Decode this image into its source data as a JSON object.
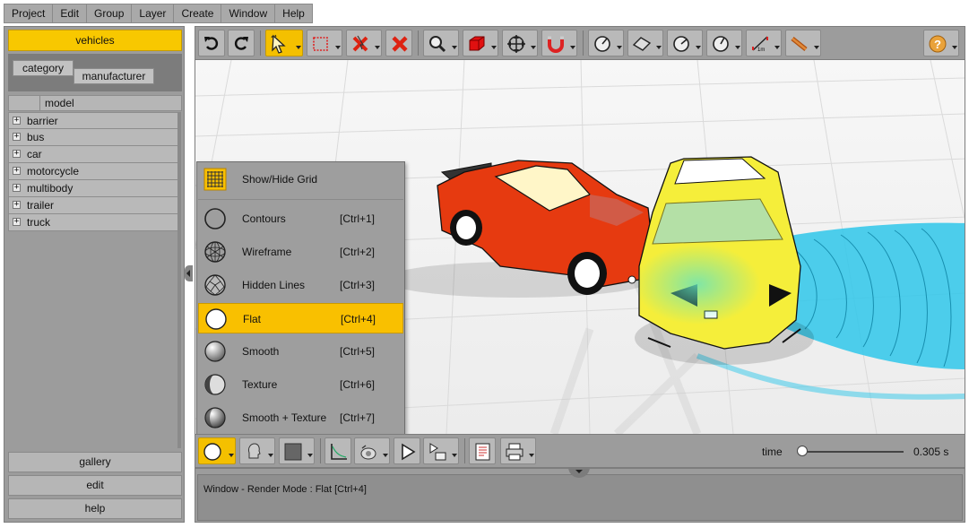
{
  "menubar": {
    "items": [
      {
        "label": "Project"
      },
      {
        "label": "Edit"
      },
      {
        "label": "Group"
      },
      {
        "label": "Layer"
      },
      {
        "label": "Create"
      },
      {
        "label": "Window"
      },
      {
        "label": "Help"
      }
    ]
  },
  "sidebar": {
    "vehicles_label": "vehicles",
    "category_tab": "category",
    "manufacturer_tab": "manufacturer",
    "tree_header": "model",
    "tree_items": [
      {
        "label": "barrier"
      },
      {
        "label": "bus"
      },
      {
        "label": "car"
      },
      {
        "label": "motorcycle"
      },
      {
        "label": "multibody"
      },
      {
        "label": "trailer"
      },
      {
        "label": "truck"
      }
    ],
    "gallery_label": "gallery",
    "edit_label": "edit",
    "help_label": "help"
  },
  "toolbar": {
    "buttons": [
      "undo-icon",
      "redo-icon",
      "select-arrow-icon",
      "selection-box-icon",
      "delete-selection-icon",
      "delete-icon",
      "zoom-icon",
      "box-icon",
      "move-icon",
      "magnet-icon",
      "measure-point-icon",
      "measure-plane-icon",
      "measure-angle-icon",
      "measure-radius-icon",
      "scale-ruler-icon",
      "tape-measure-icon",
      "help-icon"
    ],
    "scale_ruler_text": "1m"
  },
  "render_menu": {
    "items": [
      {
        "label": "Show/Hide Grid",
        "shortcut": "",
        "icon": "grid-icon"
      },
      {
        "label": "Contours",
        "shortcut": "[Ctrl+1]",
        "icon": "contours-icon"
      },
      {
        "label": "Wireframe",
        "shortcut": "[Ctrl+2]",
        "icon": "wireframe-icon"
      },
      {
        "label": "Hidden Lines",
        "shortcut": "[Ctrl+3]",
        "icon": "hidden-lines-icon"
      },
      {
        "label": "Flat",
        "shortcut": "[Ctrl+4]",
        "icon": "flat-icon"
      },
      {
        "label": "Smooth",
        "shortcut": "[Ctrl+5]",
        "icon": "smooth-icon"
      },
      {
        "label": "Texture",
        "shortcut": "[Ctrl+6]",
        "icon": "texture-icon"
      },
      {
        "label": "Smooth + Texture",
        "shortcut": "[Ctrl+7]",
        "icon": "smooth-texture-icon"
      }
    ],
    "highlighted": "Flat"
  },
  "bottom_toolbar": {
    "time_label": "time",
    "time_value": "0.305 s"
  },
  "status": {
    "text": "Window - Render Mode : Flat [Ctrl+4]"
  },
  "colors": {
    "accent": "#f9c000",
    "panel": "#9c9c9c",
    "red_car": "#e63a10",
    "yellow_car": "#f5ee3a",
    "trajectory": "#2fc7ea"
  }
}
